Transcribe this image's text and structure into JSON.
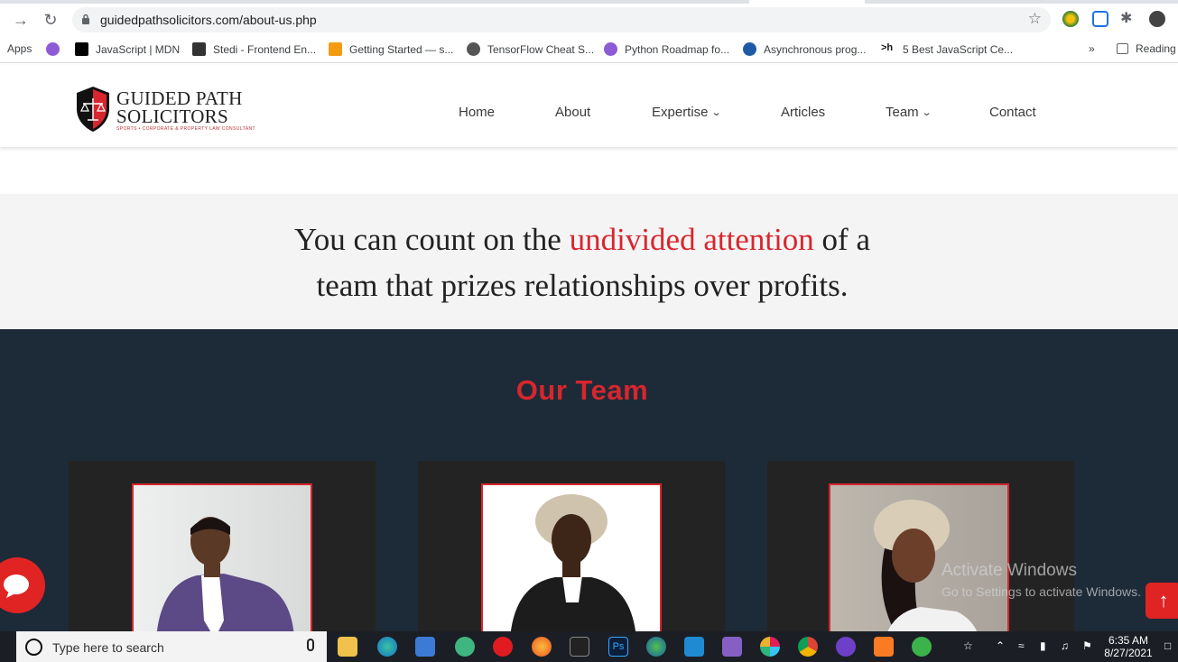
{
  "browser": {
    "url": "guidedpathsolicitors.com/about-us.php",
    "bookmarks": [
      {
        "label": "Apps"
      },
      {
        "label": "JavaScript | MDN"
      },
      {
        "label": "Stedi - Frontend En..."
      },
      {
        "label": "Getting Started — s..."
      },
      {
        "label": "TensorFlow Cheat S..."
      },
      {
        "label": "Python Roadmap fo..."
      },
      {
        "label": "Asynchronous prog..."
      },
      {
        "label": "5 Best JavaScript Ce..."
      }
    ],
    "more_label": "»",
    "reading_label": "Reading"
  },
  "site": {
    "logo_line1": "GUIDED PATH",
    "logo_line2": "SOLICITORS",
    "logo_tagline": "SPORTS • CORPORATE & PROPERTY LAW CONSULTANT",
    "nav": [
      {
        "label": "Home"
      },
      {
        "label": "About"
      },
      {
        "label": "Expertise"
      },
      {
        "label": "Articles"
      },
      {
        "label": "Team"
      },
      {
        "label": "Contact"
      }
    ]
  },
  "quote": {
    "part1": "You can count on the ",
    "highlight": "undivided attention",
    "part2": " of a",
    "line2": "team that prizes relationships over profits."
  },
  "team": {
    "title": "Our Team"
  },
  "overlay": {
    "activate_title": "Activate Windows",
    "activate_sub": "Go to Settings to activate Windows."
  },
  "taskbar": {
    "search_placeholder": "Type here to search",
    "time": "6:35 AM",
    "date": "8/27/2021"
  },
  "colors": {
    "accent": "#d7262e",
    "team_bg": "#1d2a38",
    "quote_bg": "#f4f4f4"
  }
}
